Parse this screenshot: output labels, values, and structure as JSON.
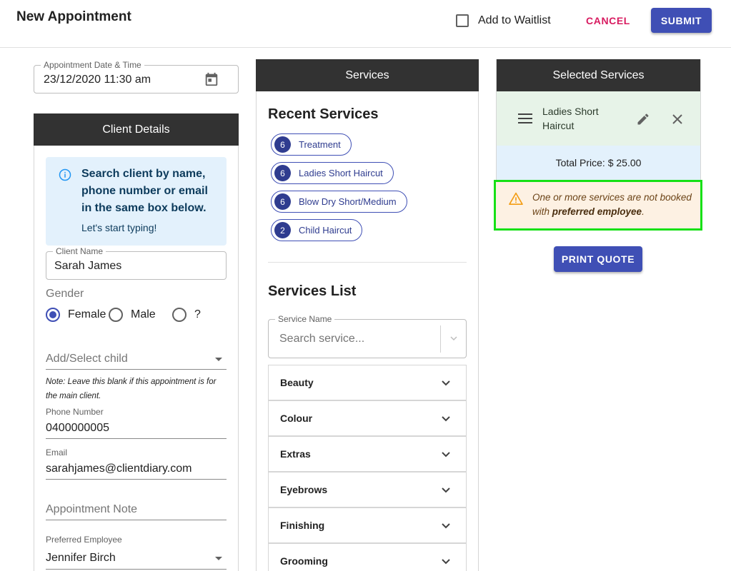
{
  "header": {
    "title": "New Appointment",
    "waitlist_label": "Add to Waitlist",
    "waitlist_checked": false,
    "cancel_label": "CANCEL",
    "submit_label": "SUBMIT"
  },
  "appointment": {
    "label": "Appointment Date & Time",
    "value": "23/12/2020 11:30 am"
  },
  "client_details": {
    "header": "Client Details",
    "info_text": "Search client by name, phone number or email in the same box below.",
    "info_sub": "Let's start typing!",
    "client_name_label": "Client Name",
    "client_name_value": "Sarah James",
    "gender_label": "Gender",
    "gender_options": [
      "Female",
      "Male",
      "?"
    ],
    "gender_selected": "Female",
    "child_placeholder": "Add/Select child",
    "note": "Note: Leave this blank if this appointment is for the main client.",
    "phone_label": "Phone Number",
    "phone_value": "0400000005",
    "email_label": "Email",
    "email_value": "sarahjames@clientdiary.com",
    "appointment_note_placeholder": "Appointment Note",
    "preferred_employee_label": "Preferred Employee",
    "preferred_employee_value": "Jennifer Birch"
  },
  "services": {
    "header": "Services",
    "recent_title": "Recent Services",
    "recent": [
      {
        "count": "6",
        "label": "Treatment"
      },
      {
        "count": "6",
        "label": "Ladies Short Haircut"
      },
      {
        "count": "6",
        "label": "Blow Dry Short/Medium"
      },
      {
        "count": "2",
        "label": "Child Haircut"
      }
    ],
    "list_title": "Services List",
    "search_label": "Service Name",
    "search_placeholder": "Search service...",
    "categories": [
      "Beauty",
      "Colour",
      "Extras",
      "Eyebrows",
      "Finishing",
      "Grooming"
    ]
  },
  "selected": {
    "header": "Selected Services",
    "items": [
      {
        "name": "Ladies Short Haircut"
      }
    ],
    "total": "Total Price: $ 25.00",
    "warning_prefix": "One or more services are not booked with ",
    "warning_bold": "preferred employee",
    "warning_suffix": ".",
    "print_label": "PRINT QUOTE"
  },
  "colors": {
    "primary": "#3f4fb5",
    "cancel": "#d81b60",
    "header_bg": "#323232",
    "warning_border": "#16e016"
  }
}
